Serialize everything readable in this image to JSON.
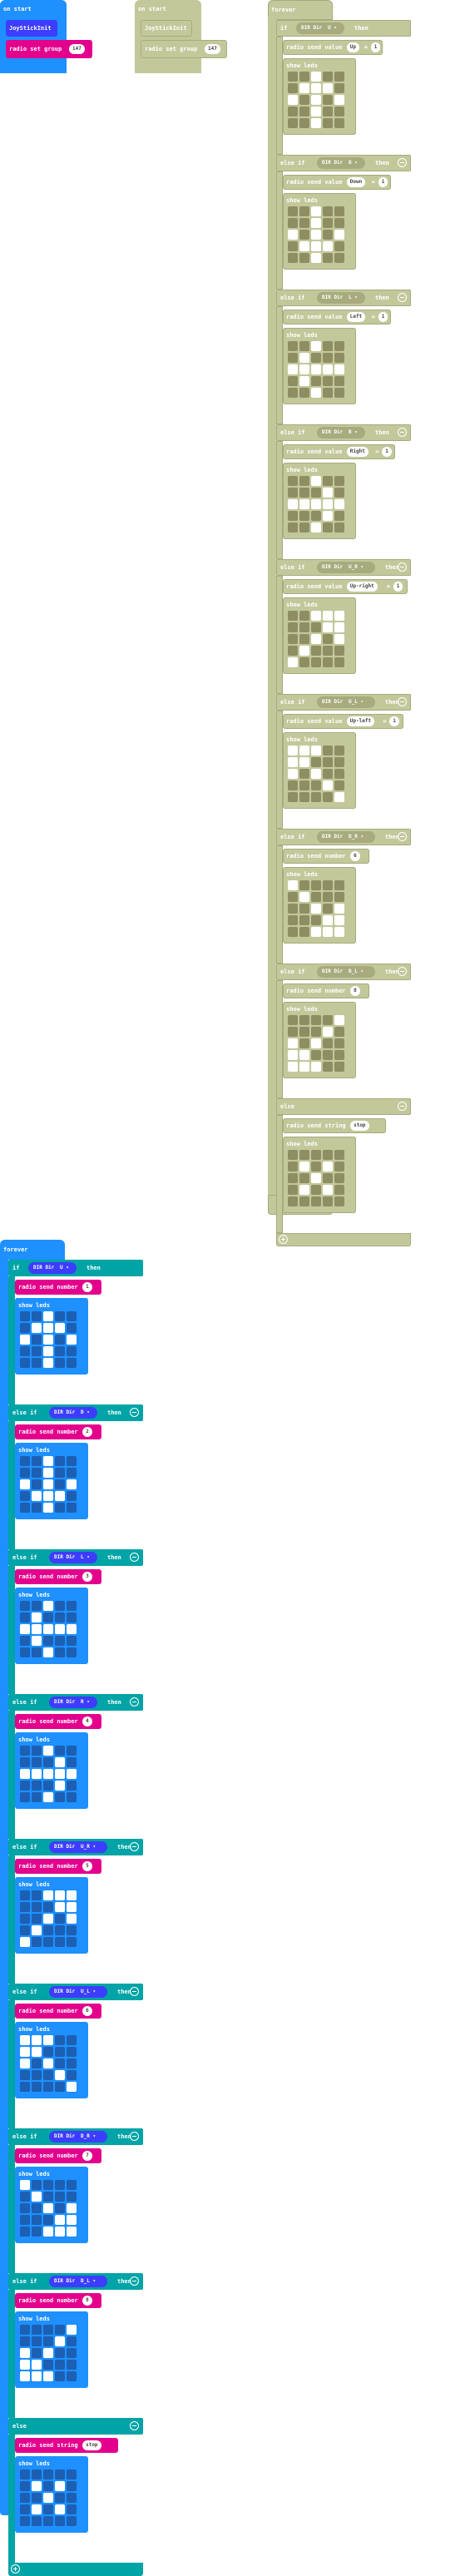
{
  "colors": {
    "basic_blue": "#1e90ff",
    "logic_teal": "#00a4a6",
    "radio_magenta": "#e3008c",
    "joystick_blue": "#3d3dff",
    "joystick_dir_blue": "#4b4bff",
    "disabled_olive": "#c3c89b",
    "disabled_dark": "#a7ab7e"
  },
  "on_start_left": {
    "header": "on start",
    "joystick_block": "JoyStickInit",
    "radio_label": "radio set group",
    "radio_value": "147"
  },
  "on_start_disabled": {
    "header": "on start",
    "joystick_block": "JoyStickInit",
    "radio_label": "radio set group",
    "radio_value": "147"
  },
  "forever_disabled": {
    "header": "forever",
    "branches": [
      {
        "kw": "if",
        "dir": "U",
        "send_label": "radio send value",
        "key": "Up",
        "value": "1",
        "show": "show leds",
        "leds": [
          0,
          0,
          1,
          0,
          0,
          0,
          1,
          1,
          1,
          0,
          1,
          0,
          1,
          0,
          1,
          0,
          0,
          1,
          0,
          0,
          0,
          0,
          1,
          0,
          0
        ]
      },
      {
        "kw": "else if",
        "dir": "D",
        "send_label": "radio send value",
        "key": "Down",
        "value": "1",
        "show": "show leds",
        "leds": [
          0,
          0,
          1,
          0,
          0,
          0,
          0,
          1,
          0,
          0,
          1,
          0,
          1,
          0,
          1,
          0,
          1,
          1,
          1,
          0,
          0,
          0,
          1,
          0,
          0
        ]
      },
      {
        "kw": "else if",
        "dir": "L",
        "send_label": "radio send value",
        "key": "Left",
        "value": "1",
        "show": "show leds",
        "leds": [
          0,
          0,
          1,
          0,
          0,
          0,
          1,
          0,
          0,
          0,
          1,
          1,
          1,
          1,
          1,
          0,
          1,
          0,
          0,
          0,
          0,
          0,
          1,
          0,
          0
        ]
      },
      {
        "kw": "else if",
        "dir": "R",
        "send_label": "radio send value",
        "key": "Right",
        "value": "1",
        "show": "show leds",
        "leds": [
          0,
          0,
          1,
          0,
          0,
          0,
          0,
          0,
          1,
          0,
          1,
          1,
          1,
          1,
          1,
          0,
          0,
          0,
          1,
          0,
          0,
          0,
          1,
          0,
          0
        ]
      },
      {
        "kw": "else if",
        "dir": "U_R",
        "send_label": "radio send value",
        "key": "Up-right",
        "value": "1",
        "show": "show leds",
        "leds": [
          0,
          0,
          1,
          1,
          1,
          0,
          0,
          0,
          1,
          1,
          0,
          0,
          1,
          0,
          1,
          0,
          1,
          0,
          0,
          0,
          1,
          0,
          0,
          0,
          0
        ]
      },
      {
        "kw": "else if",
        "dir": "U_L",
        "send_label": "radio send value",
        "key": "Up-left",
        "value": "1",
        "show": "show leds",
        "leds": [
          1,
          1,
          1,
          0,
          0,
          1,
          1,
          0,
          0,
          0,
          1,
          0,
          1,
          0,
          0,
          0,
          0,
          0,
          1,
          0,
          0,
          0,
          0,
          0,
          1
        ]
      },
      {
        "kw": "else if",
        "dir": "D_R",
        "send_label": "radio send number",
        "key": "",
        "value": "6",
        "show": "show leds",
        "leds": [
          1,
          0,
          0,
          0,
          0,
          0,
          1,
          0,
          0,
          0,
          0,
          0,
          1,
          0,
          1,
          0,
          0,
          0,
          1,
          1,
          0,
          0,
          1,
          1,
          1
        ]
      },
      {
        "kw": "else if",
        "dir": "D_L",
        "send_label": "radio send number",
        "key": "",
        "value": "8",
        "show": "show leds",
        "leds": [
          0,
          0,
          0,
          0,
          1,
          0,
          0,
          0,
          1,
          0,
          1,
          0,
          1,
          0,
          0,
          1,
          1,
          0,
          0,
          0,
          1,
          1,
          1,
          0,
          0
        ]
      }
    ],
    "else": {
      "kw": "else",
      "send_label": "radio send string",
      "value": "stop",
      "show": "show leds",
      "leds": [
        0,
        0,
        0,
        0,
        0,
        0,
        1,
        0,
        1,
        0,
        0,
        0,
        1,
        0,
        0,
        0,
        1,
        0,
        1,
        0,
        0,
        0,
        0,
        0,
        0
      ]
    },
    "then": "then",
    "dir_prefix": "DIR Dir",
    "dir_suffix": "="
  },
  "forever_active": {
    "header": "forever",
    "branches": [
      {
        "kw": "if",
        "dir": "U",
        "value": "1",
        "leds": [
          0,
          0,
          1,
          0,
          0,
          0,
          1,
          1,
          1,
          0,
          1,
          0,
          1,
          0,
          1,
          0,
          0,
          1,
          0,
          0,
          0,
          0,
          1,
          0,
          0
        ]
      },
      {
        "kw": "else if",
        "dir": "D",
        "value": "2",
        "leds": [
          0,
          0,
          1,
          0,
          0,
          0,
          0,
          1,
          0,
          0,
          1,
          0,
          1,
          0,
          1,
          0,
          1,
          1,
          1,
          0,
          0,
          0,
          1,
          0,
          0
        ]
      },
      {
        "kw": "else if",
        "dir": "L",
        "value": "3",
        "leds": [
          0,
          0,
          1,
          0,
          0,
          0,
          1,
          0,
          0,
          0,
          1,
          1,
          1,
          1,
          1,
          0,
          1,
          0,
          0,
          0,
          0,
          0,
          1,
          0,
          0
        ]
      },
      {
        "kw": "else if",
        "dir": "R",
        "value": "4",
        "leds": [
          0,
          0,
          1,
          0,
          0,
          0,
          0,
          0,
          1,
          0,
          1,
          1,
          1,
          1,
          1,
          0,
          0,
          0,
          1,
          0,
          0,
          0,
          1,
          0,
          0
        ]
      },
      {
        "kw": "else if",
        "dir": "U_R",
        "value": "5",
        "leds": [
          0,
          0,
          1,
          1,
          1,
          0,
          0,
          0,
          1,
          1,
          0,
          0,
          1,
          0,
          1,
          0,
          1,
          0,
          0,
          0,
          1,
          0,
          0,
          0,
          0
        ]
      },
      {
        "kw": "else if",
        "dir": "U_L",
        "value": "6",
        "leds": [
          1,
          1,
          1,
          0,
          0,
          1,
          1,
          0,
          0,
          0,
          1,
          0,
          1,
          0,
          0,
          0,
          0,
          0,
          1,
          0,
          0,
          0,
          0,
          0,
          1
        ]
      },
      {
        "kw": "else if",
        "dir": "D_R",
        "value": "7",
        "leds": [
          1,
          0,
          0,
          0,
          0,
          0,
          1,
          0,
          0,
          0,
          0,
          0,
          1,
          0,
          1,
          0,
          0,
          0,
          1,
          1,
          0,
          0,
          1,
          1,
          1
        ]
      },
      {
        "kw": "else if",
        "dir": "D_L",
        "value": "8",
        "leds": [
          0,
          0,
          0,
          0,
          1,
          0,
          0,
          0,
          1,
          0,
          1,
          0,
          1,
          0,
          0,
          1,
          1,
          0,
          0,
          0,
          1,
          1,
          1,
          0,
          0
        ]
      }
    ],
    "send_label": "radio send number",
    "show": "show leds",
    "then": "then",
    "dir_prefix": "DIR Dir",
    "dir_suffix": "=",
    "else": {
      "kw": "else",
      "send_label": "radio send string",
      "value": "stop",
      "show": "show leds",
      "leds": [
        0,
        0,
        0,
        0,
        0,
        0,
        1,
        0,
        1,
        0,
        0,
        0,
        1,
        0,
        0,
        0,
        1,
        0,
        1,
        0,
        0,
        0,
        0,
        0,
        0
      ]
    }
  }
}
